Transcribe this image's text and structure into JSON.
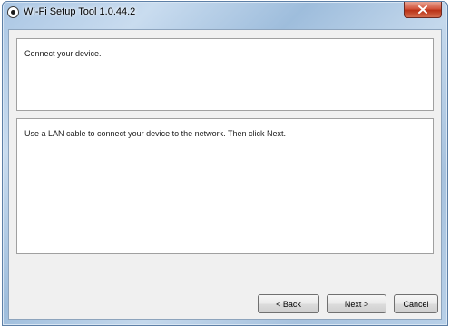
{
  "window": {
    "title": "Wi-Fi Setup Tool 1.0.44.2",
    "app_icon": "wifi-setup-app-icon",
    "close_icon": "close-icon",
    "colors": {
      "close_button": "#c94a2d",
      "client_background": "#f0f0f0",
      "panel_background": "#ffffff"
    }
  },
  "wizard": {
    "heading": "Connect your device.",
    "instruction": "Use a LAN cable to connect your device to the network. Then click Next."
  },
  "buttons": {
    "back": "< Back",
    "next": "Next >",
    "cancel": "Cancel"
  }
}
